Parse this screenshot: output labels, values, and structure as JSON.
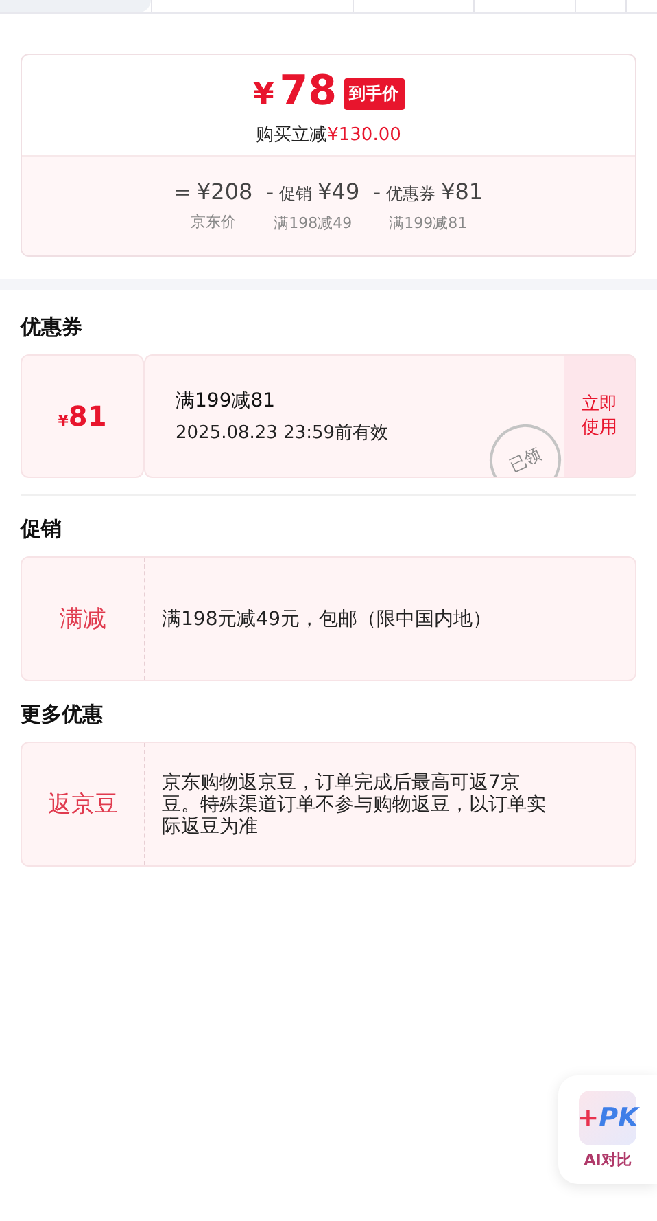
{
  "price": {
    "symbol": "¥",
    "amount": "78",
    "tag": "到手价",
    "saving_label": "购买立减",
    "saving_amount": "¥130.00",
    "breakdown": [
      {
        "op": "=",
        "value": "¥208",
        "caption": "京东价"
      },
      {
        "op": "-",
        "label": "促销",
        "value": "¥49",
        "caption": "满198减49"
      },
      {
        "op": "-",
        "label": "优惠券",
        "value": "¥81",
        "caption": "满199减81"
      }
    ]
  },
  "coupon_section": {
    "title": "优惠券",
    "coupons": [
      {
        "symbol": "¥",
        "amount": "81",
        "title": "满199减81",
        "validity": "2025.08.23 23:59前有效",
        "claimed": true,
        "stamp": "已领",
        "action": "立即使用"
      }
    ]
  },
  "promo_sections": [
    {
      "title": "促销",
      "tag": "满减",
      "text": "满198元减49元，包邮（限中国内地）"
    },
    {
      "title": "更多优惠",
      "tag": "返京豆",
      "text": "京东购物返京豆，订单完成后最高可返7京豆。特殊渠道订单不参与购物返豆，以订单实际返豆为准"
    }
  ],
  "ai_compare": {
    "logo_plus": "+",
    "logo_text": "PK",
    "label": "AI对比"
  }
}
